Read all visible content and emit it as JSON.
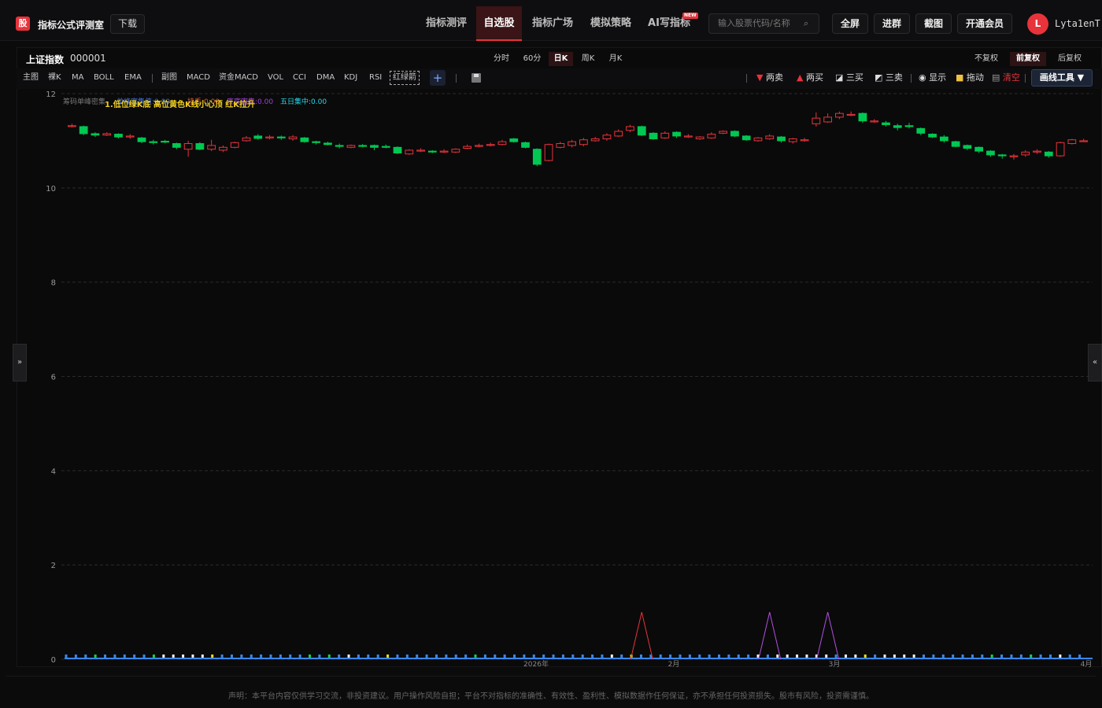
{
  "app": {
    "logo_char": "股",
    "brand": "指标公式评测室",
    "download": "下载"
  },
  "nav": [
    "指标测评",
    "自选股",
    "指标广场",
    "模拟策略",
    "AI写指标"
  ],
  "nav_active": 1,
  "new_badge": "NEW",
  "search": {
    "placeholder": "输入股票代码/名称"
  },
  "top_buttons": [
    "全屏",
    "进群",
    "截图",
    "开通会员"
  ],
  "user": {
    "avatar": "L",
    "name": "Lyta1enT"
  },
  "stock": {
    "name": "上证指数",
    "code": "000001"
  },
  "periods": [
    "分时",
    "60分",
    "日K",
    "周K",
    "月K"
  ],
  "period_active": 2,
  "adjust": [
    "不复权",
    "前复权",
    "后复权"
  ],
  "adjust_active": 1,
  "indicators_main": [
    "主图",
    "裸K",
    "MA",
    "BOLL",
    "EMA"
  ],
  "indicators_sub": [
    "副图",
    "MACD",
    "资金MACD",
    "VOL",
    "CCI",
    "DMA",
    "KDJ",
    "RSI",
    "红绿箭"
  ],
  "tools": {
    "two_sell": "两卖",
    "two_buy": "两买",
    "three_buy": "三买",
    "three_sell": "三卖",
    "show": "显示",
    "drag": "拖动",
    "clear": "清空",
    "draw_tools": "画线工具 ▼"
  },
  "legend": {
    "line1_a": "筹码单峰密集",
    "line1_b": "单峰密集值:0.00",
    "line1_c": "挂丢:0.00",
    "line1_d": "底底密集:0.00",
    "line1_e": "五日集中:0.00",
    "overlay": "1.低位绿K底 高位黄色K线小心顶 红K拉升"
  },
  "colors": {
    "up": "#e8333b",
    "down": "#00c853",
    "accent": "#e8333b"
  },
  "chart_data": {
    "type": "candlestick",
    "ylim": [
      0,
      12
    ],
    "yticks": [
      0,
      2,
      4,
      6,
      8,
      10,
      12
    ],
    "x_labels": [
      "2026年",
      "2月",
      "3月",
      "4月"
    ],
    "candles": [
      [
        11.32,
        11.32,
        11.36,
        11.28
      ],
      [
        11.3,
        11.15,
        11.32,
        11.12
      ],
      [
        11.15,
        11.12,
        11.18,
        11.08
      ],
      [
        11.12,
        11.15,
        11.18,
        11.1
      ],
      [
        11.14,
        11.08,
        11.16,
        11.05
      ],
      [
        11.08,
        11.1,
        11.14,
        11.04
      ],
      [
        11.06,
        10.98,
        11.08,
        10.95
      ],
      [
        10.98,
        10.96,
        11.02,
        10.92
      ],
      [
        10.99,
        10.98,
        11.02,
        10.95
      ],
      [
        10.94,
        10.86,
        10.96,
        10.82
      ],
      [
        10.82,
        10.94,
        11.0,
        10.66
      ],
      [
        10.94,
        10.82,
        10.97,
        10.8
      ],
      [
        10.82,
        10.9,
        11.02,
        10.78
      ],
      [
        10.8,
        10.86,
        10.9,
        10.76
      ],
      [
        10.86,
        10.96,
        10.98,
        10.84
      ],
      [
        11.0,
        11.06,
        11.1,
        10.98
      ],
      [
        11.1,
        11.05,
        11.14,
        11.02
      ],
      [
        11.06,
        11.08,
        11.12,
        11.03
      ],
      [
        11.08,
        11.06,
        11.11,
        11.02
      ],
      [
        11.04,
        11.08,
        11.12,
        11.0
      ],
      [
        11.06,
        10.98,
        11.08,
        10.96
      ],
      [
        10.98,
        10.96,
        11.0,
        10.92
      ],
      [
        10.95,
        10.92,
        10.98,
        10.9
      ],
      [
        10.9,
        10.88,
        10.94,
        10.84
      ],
      [
        10.86,
        10.9,
        10.92,
        10.84
      ],
      [
        10.9,
        10.88,
        10.93,
        10.86
      ],
      [
        10.9,
        10.86,
        10.92,
        10.8
      ],
      [
        10.88,
        10.86,
        10.92,
        10.84
      ],
      [
        10.86,
        10.74,
        10.88,
        10.72
      ],
      [
        10.72,
        10.8,
        10.82,
        10.7
      ],
      [
        10.78,
        10.8,
        10.84,
        10.76
      ],
      [
        10.78,
        10.76,
        10.8,
        10.74
      ],
      [
        10.76,
        10.78,
        10.82,
        10.74
      ],
      [
        10.76,
        10.82,
        10.84,
        10.74
      ],
      [
        10.84,
        10.88,
        10.92,
        10.82
      ],
      [
        10.88,
        10.9,
        10.94,
        10.86
      ],
      [
        10.9,
        10.92,
        10.96,
        10.88
      ],
      [
        10.92,
        10.98,
        11.02,
        10.9
      ],
      [
        11.04,
        10.98,
        11.06,
        10.96
      ],
      [
        10.96,
        10.86,
        10.98,
        10.84
      ],
      [
        10.82,
        10.5,
        10.84,
        10.46
      ],
      [
        10.58,
        10.92,
        10.94,
        10.56
      ],
      [
        10.86,
        10.94,
        10.98,
        10.84
      ],
      [
        10.9,
        10.98,
        11.02,
        10.86
      ],
      [
        10.92,
        11.02,
        11.06,
        10.88
      ],
      [
        11.0,
        11.04,
        11.08,
        10.98
      ],
      [
        11.04,
        11.12,
        11.16,
        11.0
      ],
      [
        11.1,
        11.2,
        11.24,
        11.08
      ],
      [
        11.22,
        11.3,
        11.34,
        11.18
      ],
      [
        11.3,
        11.12,
        11.32,
        11.1
      ],
      [
        11.16,
        11.04,
        11.18,
        11.02
      ],
      [
        11.06,
        11.16,
        11.2,
        11.04
      ],
      [
        11.18,
        11.1,
        11.2,
        11.06
      ],
      [
        11.1,
        11.1,
        11.14,
        11.06
      ],
      [
        11.04,
        11.08,
        11.1,
        11.02
      ],
      [
        11.06,
        11.14,
        11.18,
        11.04
      ],
      [
        11.16,
        11.2,
        11.22,
        11.14
      ],
      [
        11.2,
        11.1,
        11.22,
        11.08
      ],
      [
        11.1,
        11.02,
        11.12,
        11.0
      ],
      [
        11.0,
        11.06,
        11.08,
        10.98
      ],
      [
        11.04,
        11.1,
        11.14,
        11.02
      ],
      [
        11.08,
        11.0,
        11.1,
        10.96
      ],
      [
        10.98,
        11.04,
        11.06,
        10.94
      ],
      [
        11.0,
        11.02,
        11.06,
        10.98
      ],
      [
        11.36,
        11.48,
        11.6,
        11.3
      ],
      [
        11.4,
        11.5,
        11.58,
        11.38
      ],
      [
        11.5,
        11.58,
        11.62,
        11.46
      ],
      [
        11.56,
        11.56,
        11.62,
        11.52
      ],
      [
        11.58,
        11.42,
        11.6,
        11.38
      ],
      [
        11.42,
        11.42,
        11.46,
        11.38
      ],
      [
        11.38,
        11.34,
        11.42,
        11.3
      ],
      [
        11.32,
        11.28,
        11.36,
        11.22
      ],
      [
        11.32,
        11.3,
        11.38,
        11.26
      ],
      [
        11.26,
        11.16,
        11.28,
        11.12
      ],
      [
        11.14,
        11.08,
        11.16,
        11.06
      ],
      [
        11.08,
        11.0,
        11.12,
        10.96
      ],
      [
        10.98,
        10.88,
        11.0,
        10.86
      ],
      [
        10.9,
        10.84,
        10.92,
        10.8
      ],
      [
        10.86,
        10.78,
        10.88,
        10.74
      ],
      [
        10.78,
        10.7,
        10.8,
        10.66
      ],
      [
        10.7,
        10.68,
        10.72,
        10.62
      ],
      [
        10.66,
        10.68,
        10.72,
        10.6
      ],
      [
        10.7,
        10.76,
        10.8,
        10.66
      ],
      [
        10.76,
        10.78,
        10.82,
        10.72
      ],
      [
        10.76,
        10.68,
        10.78,
        10.64
      ],
      [
        10.68,
        10.96,
        10.98,
        10.66
      ],
      [
        10.94,
        11.02,
        11.04,
        10.92
      ],
      [
        11.0,
        11.0,
        11.04,
        10.98
      ]
    ],
    "bottom_markers": "bbbgbbbbbgwwwwwybbbbbbbbbgbgbwbbbybbbbbbbbgbbbbbbbbbbbbbwbybbbbbbbbbbbbwbwwwwwwbwwybwwwwbbbbbbbgbbbgbbwbb",
    "spikes": [
      {
        "index": 49,
        "value": 1.0,
        "color": "#e8333b"
      },
      {
        "index": 60,
        "value": 1.0,
        "color": "#b050e0"
      },
      {
        "index": 65,
        "value": 1.0,
        "color": "#b050e0"
      }
    ]
  },
  "footer": "声明：本平台内容仅供学习交流，非投资建议。用户操作风险自担；平台不对指标的准确性、有效性、盈利性、模拟数据作任何保证，亦不承担任何投资损失。股市有风险，投资需谨慎。"
}
